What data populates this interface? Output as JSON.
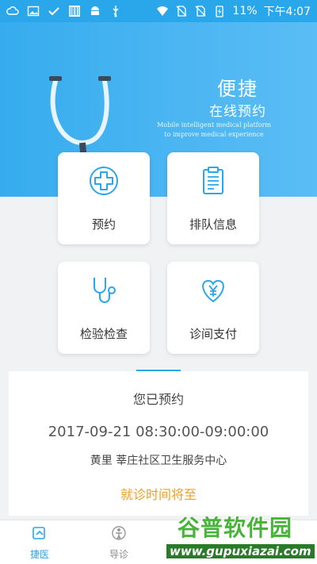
{
  "status_bar": {
    "battery": "11%",
    "time": "下午4:07",
    "icons": [
      "cloud-icon",
      "image-icon",
      "check-icon",
      "barcode-icon",
      "android-icon",
      "usb-icon",
      "wifi-icon",
      "no-sim-icon",
      "no-sim-icon",
      "battery-charging-icon"
    ]
  },
  "hero": {
    "title": "便捷",
    "subtitle": "在线预约",
    "tagline": "Mobile intelligent medical platform to improve medical experience"
  },
  "tiles": [
    {
      "label": "预约",
      "icon": "medical-cross-icon"
    },
    {
      "label": "排队信息",
      "icon": "clipboard-icon"
    },
    {
      "label": "检验检查",
      "icon": "stethoscope-icon"
    },
    {
      "label": "诊间支付",
      "icon": "heart-yuan-icon"
    }
  ],
  "booking": {
    "title": "您已预约",
    "time": "2017-09-21 08:30:00-09:00:00",
    "clinic": "黄里 莘庄社区卫生服务中心",
    "status": "就诊时间将至"
  },
  "bottom_nav": [
    {
      "label": "捷医",
      "icon": "quick-doctor-icon",
      "active": true
    },
    {
      "label": "导诊",
      "icon": "guide-person-icon",
      "active": false
    }
  ],
  "watermark": {
    "logo": "谷普软件园",
    "url": "www.gupuxiazai.com"
  },
  "colors": {
    "primary": "#29a7ea",
    "status_warning": "#f0a020",
    "watermark_green": "#49b43a"
  }
}
